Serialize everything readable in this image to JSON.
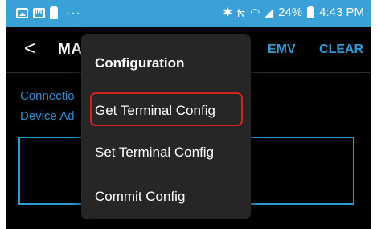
{
  "status_bar": {
    "time": "4:43 PM",
    "battery_percent": "24%",
    "icons": [
      "image-icon",
      "mail-icon",
      "android-icon",
      "more-dots-icon",
      "bluetooth-icon",
      "vibrate-icon",
      "wifi-icon",
      "signal-icon",
      "battery-icon"
    ]
  },
  "app_bar": {
    "title": "MA",
    "back_glyph": "<",
    "actions": [
      "EMV",
      "CLEAR"
    ]
  },
  "content": {
    "line1": "Connectio",
    "line2": "Device Ad"
  },
  "menu": {
    "title": "Configuration",
    "items": [
      {
        "label": "Get Terminal Config",
        "highlighted": true
      },
      {
        "label": "Set Terminal Config",
        "highlighted": false
      },
      {
        "label": "Commit Config",
        "highlighted": false
      }
    ]
  },
  "colors": {
    "status_bar": "#3aa0d8",
    "accent": "#2e9ad4",
    "menu_bg": "#262626",
    "highlight_border": "#d0231f"
  }
}
